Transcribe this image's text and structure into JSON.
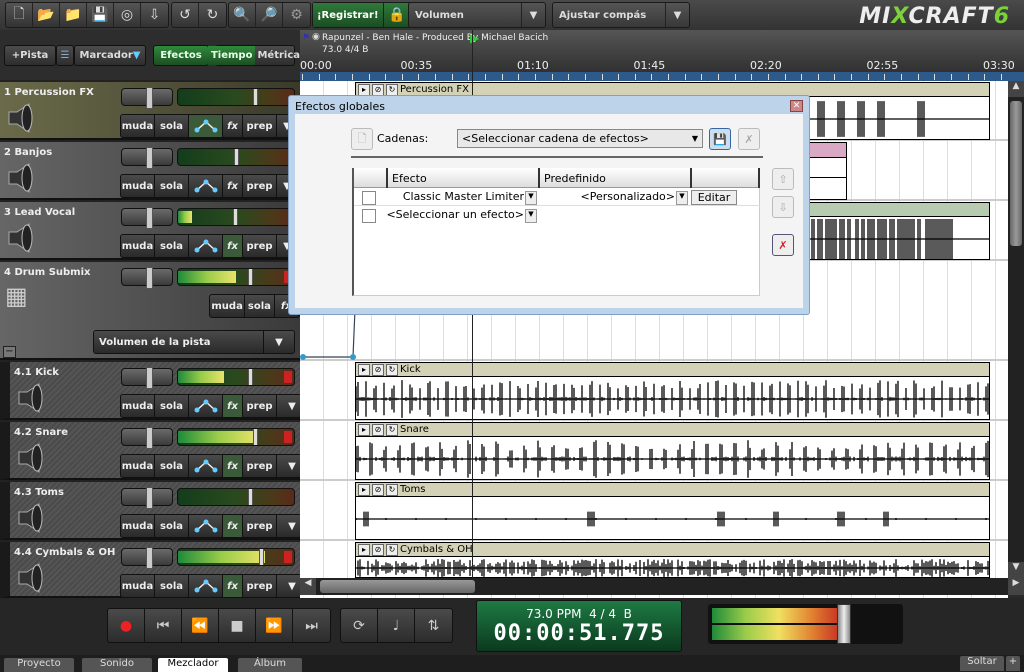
{
  "toolbar": {
    "icons": [
      "new-icon",
      "open-icon",
      "open-music-icon",
      "save-icon",
      "burn-cd-icon",
      "export-icon",
      "undo-icon",
      "redo-icon",
      "zoom-in-icon",
      "zoom-out-icon",
      "settings-icon"
    ],
    "register_label": "¡Registrar!",
    "volume_dropdown": "Volumen",
    "snap_dropdown": "Ajustar compás",
    "logo": "MIXCRAFT6"
  },
  "left_header": {
    "add_track": "+Pista",
    "marker": "Marcador",
    "effects": "Efectos",
    "time": "Tiempo",
    "metric": "Métrica"
  },
  "track_buttons": {
    "mute": "muda",
    "solo": "sola",
    "fx": "fx",
    "prep": "prep"
  },
  "tracks": [
    {
      "name": "1 Percussion FX",
      "volume": 0.65,
      "meter": 0
    },
    {
      "name": "2 Banjos",
      "volume": 0.48,
      "meter": 0
    },
    {
      "name": "3 Lead Vocal",
      "volume": 0.47,
      "meter": 0.12
    },
    {
      "name": "4 Drum Submix",
      "volume": 0.6,
      "meter": 0.5,
      "automation": "Volumen de la pista"
    },
    {
      "name": "4.1 Kick",
      "volume": 0.6,
      "meter": 0.4
    },
    {
      "name": "4.2 Snare",
      "volume": 0.65,
      "meter": 0.68
    },
    {
      "name": "4.3 Toms",
      "volume": 0.6,
      "meter": 0
    },
    {
      "name": "4.4 Cymbals & OH",
      "volume": 0.7,
      "meter": 0.75
    }
  ],
  "timeline": {
    "song_info": "Rapunzel - Ben Hale - Produced By Michael Bacich",
    "tempo_info": "73.0 4/4 B",
    "ruler": [
      "00:00",
      "00:35",
      "01:10",
      "01:45",
      "02:20",
      "02:55",
      "03:30"
    ],
    "playhead_seconds": 51.775,
    "clips": [
      "Percussion FX",
      "Kick",
      "Snare",
      "Toms",
      "Cymbals & OH"
    ]
  },
  "dialog": {
    "title": "Efectos globales",
    "chains_label": "Cadenas:",
    "chain_select": "<Seleccionar cadena de efectos>",
    "columns": [
      "Efecto",
      "Predefinido"
    ],
    "rows": [
      {
        "effect": "Classic Master Limiter",
        "preset": "<Personalizado>",
        "edit": "Editar"
      },
      {
        "effect": "<Seleccionar un efecto>"
      }
    ]
  },
  "transport": {
    "tempo": "73.0 PPM",
    "signature": "4 / 4",
    "key": "B",
    "time": "00:00:51.775",
    "master_level": 0.7
  },
  "tabs": [
    "Proyecto",
    "Sonido",
    "Mezclador",
    "Álbum"
  ],
  "active_tab": "Mezclador",
  "undock": "Soltar"
}
